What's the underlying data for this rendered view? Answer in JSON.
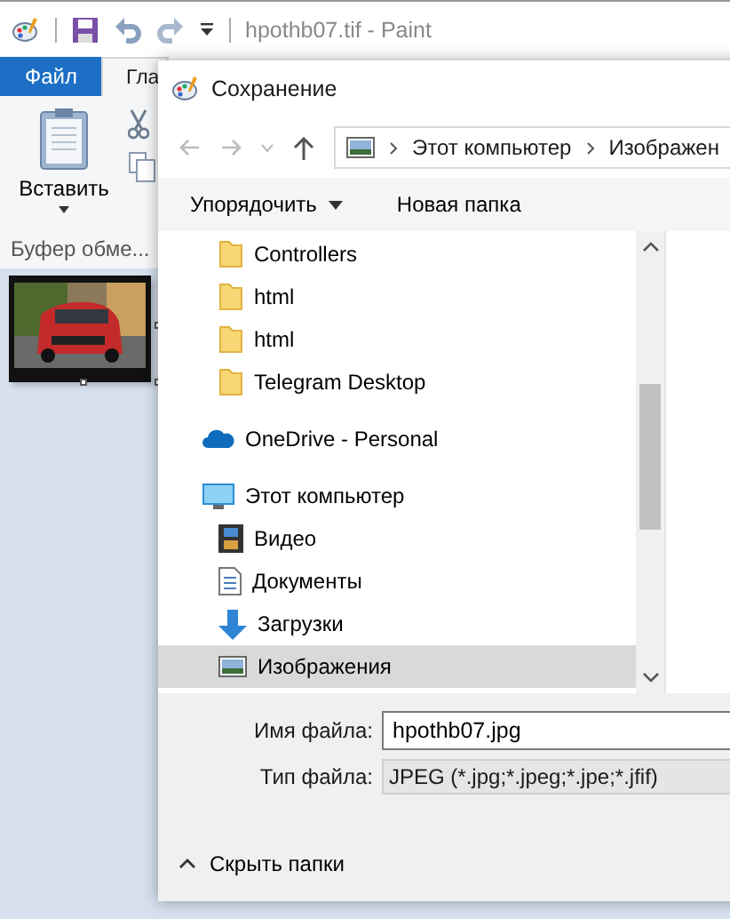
{
  "paint": {
    "title": "hpothb07.tif - Paint",
    "tabs": [
      {
        "kind": "file",
        "label": "Файл",
        "selected": false
      },
      {
        "kind": "home",
        "label": "Гла",
        "selected": true
      }
    ],
    "paste_label": "Вставить",
    "group_label": "Буфер обме..."
  },
  "dialog": {
    "title": "Сохранение",
    "breadcrumbs": [
      "Этот компьютер",
      "Изображен"
    ],
    "toolbar": {
      "organize": "Упорядочить",
      "new_folder": "Новая папка"
    },
    "nav": [
      {
        "kind": "folder",
        "label": "Controllers",
        "selected": false
      },
      {
        "kind": "folder",
        "label": "html",
        "selected": false
      },
      {
        "kind": "folder",
        "label": "html",
        "selected": false
      },
      {
        "kind": "folder",
        "label": "Telegram Desktop",
        "selected": false
      },
      {
        "kind": "cloud",
        "label": "OneDrive - Personal",
        "selected": false
      },
      {
        "kind": "pc",
        "label": "Этот компьютер",
        "selected": false,
        "children": [
          {
            "kind": "video",
            "label": "Видео",
            "selected": false
          },
          {
            "kind": "documents",
            "label": "Документы",
            "selected": false
          },
          {
            "kind": "downloads",
            "label": "Загрузки",
            "selected": false
          },
          {
            "kind": "pictures",
            "label": "Изображения",
            "selected": true
          }
        ]
      }
    ],
    "file_name": {
      "label": "Имя файла:",
      "value": "hpothb07.jpg"
    },
    "file_type": {
      "label": "Тип файла:",
      "value": "JPEG (*.jpg;*.jpeg;*.jpe;*.jfif)"
    },
    "hide_folders": "Скрыть папки"
  }
}
